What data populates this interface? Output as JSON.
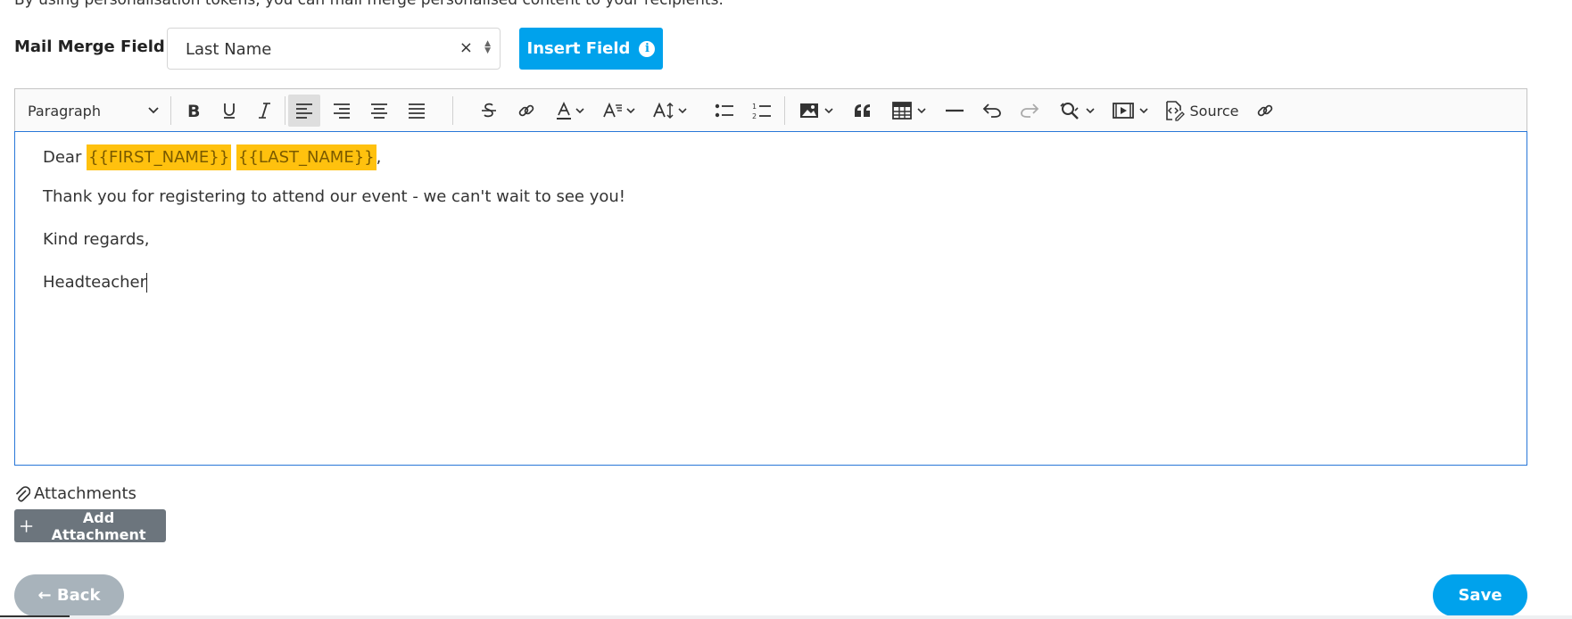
{
  "intro_text": "By using personalisation tokens, you can mail merge personalised content to your recipients.",
  "merge_field": {
    "label": "Mail Merge Field",
    "selected_value": "Last Name",
    "clear_symbol": "×",
    "insert_label": "Insert Field"
  },
  "toolbar": {
    "paragraph_label": "Paragraph",
    "source_label": "Source",
    "icons": [
      "bold-icon",
      "underline-icon",
      "italic-icon",
      "align-left-icon",
      "align-right-icon",
      "align-center-icon",
      "align-justify-icon",
      "strikethrough-icon",
      "link-icon",
      "font-color-icon",
      "font-style-icon",
      "font-size-icon",
      "bulleted-list-icon",
      "numbered-list-icon",
      "image-icon",
      "blockquote-icon",
      "table-icon",
      "horizontal-line-icon",
      "undo-icon",
      "redo-icon",
      "find-replace-icon",
      "media-embed-icon",
      "source-icon",
      "link-unlink-icon"
    ]
  },
  "content": {
    "greeting": "Dear",
    "token_first": "{{FIRST_NAME}}",
    "token_last": "{{LAST_NAME}}",
    "greeting_punct": ",",
    "line2": "Thank you for registering to attend our event - we can't wait to see you!",
    "line3": "Kind regards,",
    "line4": "Headteacher"
  },
  "attachments": {
    "label": "Attachments",
    "add_label": "Add Attachment"
  },
  "buttons": {
    "back_label": "Back",
    "save_label": "Save"
  },
  "colors": {
    "primary": "#00a2ec",
    "token_bg": "#ffc10e",
    "secondary": "#6c757d",
    "back_bg": "#a8b3bb",
    "editor_border": "#2977d8"
  }
}
